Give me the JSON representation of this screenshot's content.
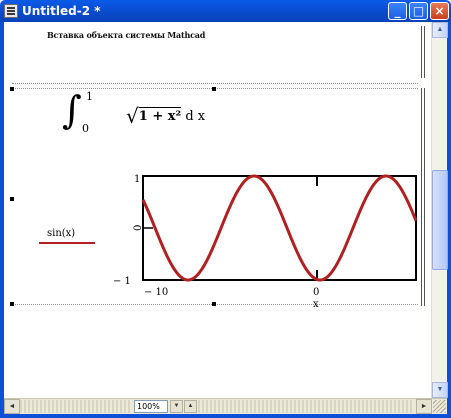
{
  "window": {
    "title": "Untitled-2 *",
    "controls": {
      "minimize": "_",
      "maximize": "□",
      "close": "×"
    }
  },
  "document": {
    "inserted_heading": "Вставка объекта системы Mathcad",
    "integral": {
      "sign": "∫",
      "upper_limit": "1",
      "lower_limit": "0",
      "radical": "√",
      "radicand": "1 + x²",
      "differential": "d x"
    },
    "plot": {
      "legend_label": "sin(x)",
      "y_axis_label": "0",
      "x_axis_label": "x",
      "y_tick_top": "1",
      "y_tick_bottom": "− 1",
      "x_tick_left": "− 10",
      "x_tick_mid": "0"
    }
  },
  "status_bar": {
    "zoom": "100%",
    "zoom_down": "▼",
    "zoom_up": "▲"
  },
  "colors": {
    "titlebar": "#0a4fd6",
    "curve": "#b02020"
  },
  "icons": {
    "app": "mathcad-document-icon",
    "scroll_up": "arrow-up-icon",
    "scroll_down": "arrow-down-icon",
    "scroll_left": "arrow-left-icon",
    "scroll_right": "arrow-right-icon"
  },
  "chart_data": {
    "type": "line",
    "series": [
      {
        "name": "sin(x)",
        "function": "sin(x)",
        "color": "#b02020"
      }
    ],
    "x_range": [
      -10,
      3
    ],
    "y_range": [
      -1,
      1
    ],
    "x_ticks": [
      -10,
      0
    ],
    "y_ticks": [
      -1,
      0,
      1
    ],
    "xlabel": "x",
    "grid": false
  }
}
